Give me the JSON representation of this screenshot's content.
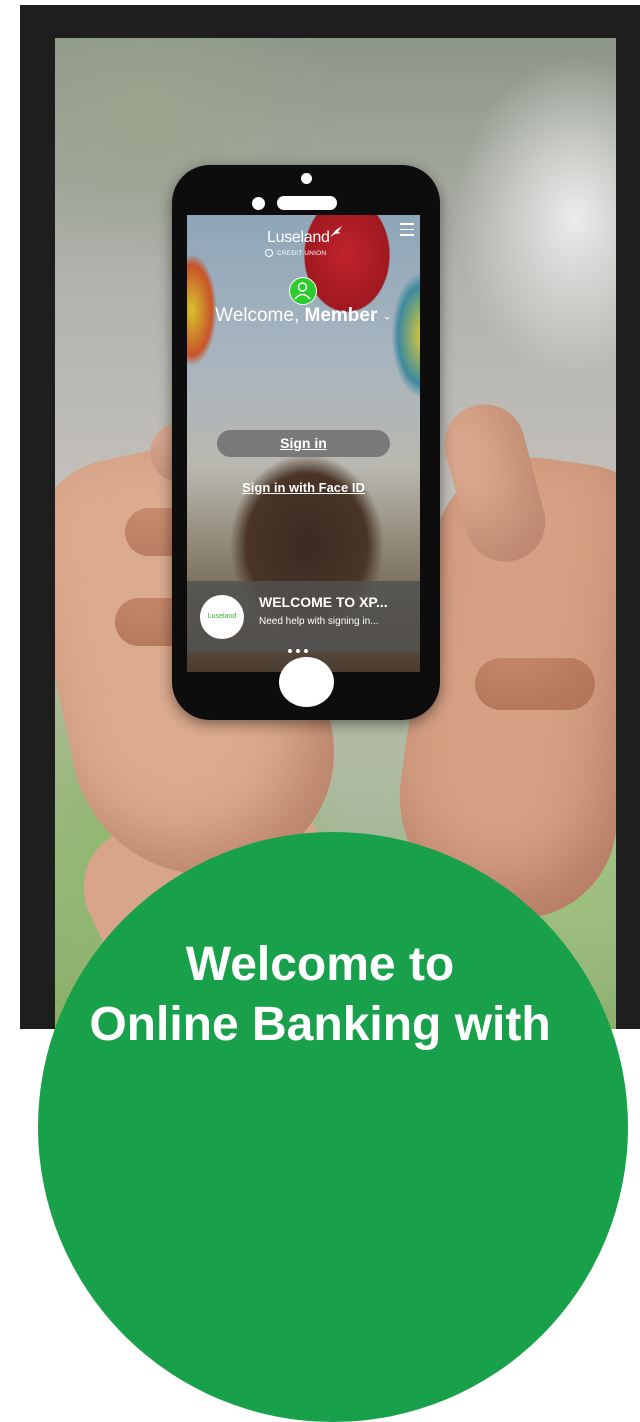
{
  "phone_app": {
    "logo": {
      "name": "Luseland",
      "subtitle": "CREDIT UNION"
    },
    "welcome_prefix": "Welcome,",
    "member_name": "Member",
    "sign_in_label": "Sign in",
    "face_id_label": "Sign in with Face ID",
    "banner": {
      "logo_text": "Luseland",
      "title": "WELCOME TO XP...",
      "subtitle": "Need help with signing in..."
    },
    "carousel_dots": 3
  },
  "headline": {
    "line1": "Welcome to",
    "line2": "Online Banking with"
  },
  "colors": {
    "brand_green": "#18a14a",
    "avatar_green": "#2fcc2f",
    "frame": "#1e1e1e"
  }
}
